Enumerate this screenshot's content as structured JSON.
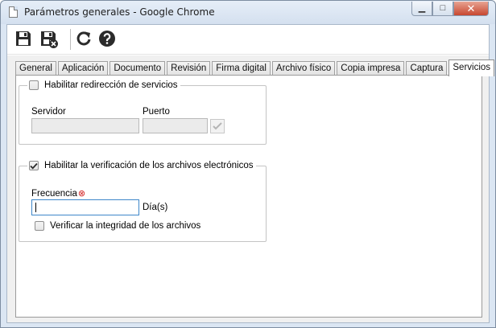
{
  "window": {
    "title": "Parámetros generales - Google Chrome",
    "minimize_glyph": "▁",
    "maximize_glyph": "□",
    "close_glyph": "✕"
  },
  "toolbar": {
    "icons": [
      "save-icon",
      "save-and-close-icon",
      "refresh-icon",
      "help-icon"
    ]
  },
  "tabs": [
    {
      "label": "General",
      "active": false
    },
    {
      "label": "Aplicación",
      "active": false
    },
    {
      "label": "Documento",
      "active": false
    },
    {
      "label": "Revisión",
      "active": false
    },
    {
      "label": "Firma digital",
      "active": false
    },
    {
      "label": "Archivo físico",
      "active": false
    },
    {
      "label": "Copia impresa",
      "active": false
    },
    {
      "label": "Captura",
      "active": false
    },
    {
      "label": "Servicios",
      "active": true
    }
  ],
  "services": {
    "redirect": {
      "label": "Habilitar redirección de servicios",
      "checked": false,
      "server_label": "Servidor",
      "server_value": "",
      "port_label": "Puerto",
      "port_value": ""
    },
    "verification": {
      "label": "Habilitar la verificación de los archivos electrónicos",
      "checked": true,
      "frequency_label": "Frecuencia",
      "frequency_value": "",
      "frequency_unit": "Día(s)",
      "integrity_label": "Verificar la integridad de los archivos",
      "integrity_checked": false
    }
  },
  "colors": {
    "accent": "#3e87c9",
    "required": "#d11a1a"
  }
}
